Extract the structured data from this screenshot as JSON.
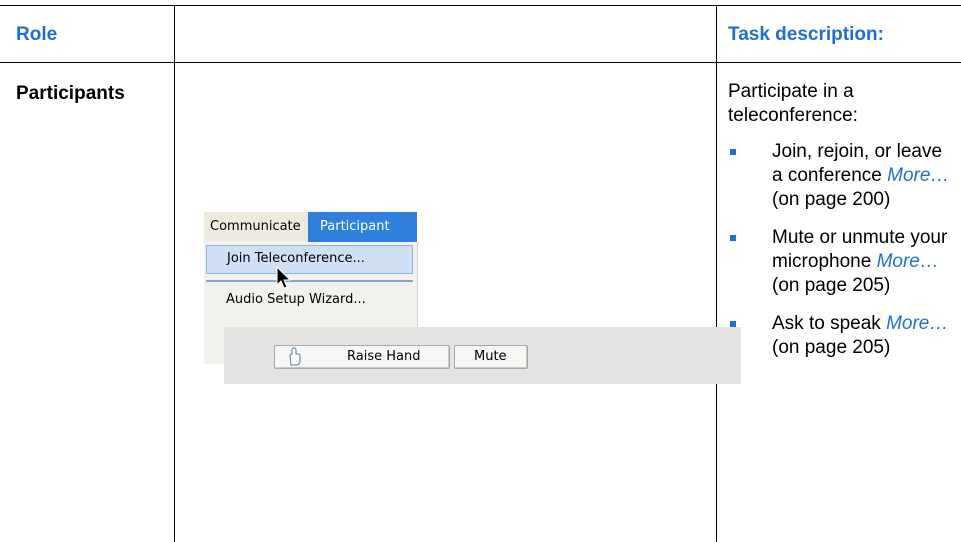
{
  "table": {
    "header": {
      "role": "Role",
      "task": "Task description:"
    },
    "row": {
      "role": "Participants",
      "task_intro": "Participate in a teleconference:",
      "tasks": [
        {
          "text": "Join, rejoin, or leave a conference",
          "link": "More…",
          "ref": "(on page 200)"
        },
        {
          "text": "Mute or unmute your microphone",
          "link": "More…",
          "ref": "(on page 205)"
        },
        {
          "text": "Ask to speak",
          "link": "More…",
          "ref": "(on page 205)"
        }
      ]
    }
  },
  "screenshot": {
    "menu": {
      "communicate": "Communicate",
      "participant": "Participant"
    },
    "dropdown": {
      "join": "Join Teleconference...",
      "audio": "Audio Setup Wizard..."
    },
    "buttons": {
      "raise_hand": "Raise Hand",
      "mute": "Mute"
    },
    "colors": {
      "accent": "#1f6fd1",
      "menu_highlight": "#2f7fdc"
    },
    "icons": {
      "cursor": "arrow-cursor-icon",
      "hand": "raise-hand-icon"
    }
  }
}
